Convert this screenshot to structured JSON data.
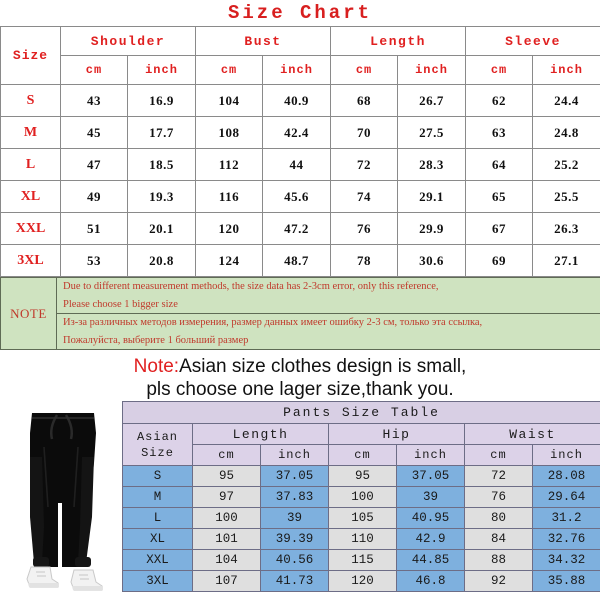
{
  "title": "Size  Chart",
  "shirt_table": {
    "size_header": "Size",
    "groups": [
      "Shoulder",
      "Bust",
      "Length",
      "Sleeve"
    ],
    "units": [
      "cm",
      "inch",
      "cm",
      "inch",
      "cm",
      "inch",
      "cm",
      "inch"
    ],
    "rows": [
      {
        "size": "S",
        "values": [
          "43",
          "16.9",
          "104",
          "40.9",
          "68",
          "26.7",
          "62",
          "24.4"
        ]
      },
      {
        "size": "M",
        "values": [
          "45",
          "17.7",
          "108",
          "42.4",
          "70",
          "27.5",
          "63",
          "24.8"
        ]
      },
      {
        "size": "L",
        "values": [
          "47",
          "18.5",
          "112",
          "44",
          "72",
          "28.3",
          "64",
          "25.2"
        ]
      },
      {
        "size": "XL",
        "values": [
          "49",
          "19.3",
          "116",
          "45.6",
          "74",
          "29.1",
          "65",
          "25.5"
        ]
      },
      {
        "size": "XXL",
        "values": [
          "51",
          "20.1",
          "120",
          "47.2",
          "76",
          "29.9",
          "67",
          "26.3"
        ]
      },
      {
        "size": "3XL",
        "values": [
          "53",
          "20.8",
          "124",
          "48.7",
          "78",
          "30.6",
          "69",
          "27.1"
        ]
      }
    ]
  },
  "note_block": {
    "label": "NOTE",
    "english_line1": "Due to different measurement methods, the size data has 2-3cm error, only this reference,",
    "english_line2": "Please choose 1 bigger size",
    "russian_line1": "Из-за различных методов измерения, размер данных имеет ошибку 2-3 см, только эта ссылка,",
    "russian_line2": "Пожалуйста, выберите 1 больший размер"
  },
  "asian_note": {
    "prefix": "Note:",
    "line1": "Asian size clothes design is small,",
    "line2": "pls choose one lager size,thank you."
  },
  "pants_table": {
    "title": "Pants Size Table",
    "size_header_line1": "Asian",
    "size_header_line2": "Size",
    "groups": [
      "Length",
      "Hip",
      "Waist"
    ],
    "units": [
      "cm",
      "inch",
      "cm",
      "inch",
      "cm",
      "inch"
    ],
    "rows": [
      {
        "size": "S",
        "values": [
          "95",
          "37.05",
          "95",
          "37.05",
          "72",
          "28.08"
        ]
      },
      {
        "size": "M",
        "values": [
          "97",
          "37.83",
          "100",
          "39",
          "76",
          "29.64"
        ]
      },
      {
        "size": "L",
        "values": [
          "100",
          "39",
          "105",
          "40.95",
          "80",
          "31.2"
        ]
      },
      {
        "size": "XL",
        "values": [
          "101",
          "39.39",
          "110",
          "42.9",
          "84",
          "32.76"
        ]
      },
      {
        "size": "XXL",
        "values": [
          "104",
          "40.56",
          "115",
          "44.85",
          "88",
          "34.32"
        ]
      },
      {
        "size": "3XL",
        "values": [
          "107",
          "41.73",
          "120",
          "46.8",
          "92",
          "35.88"
        ]
      }
    ]
  },
  "product_photo": {
    "alt": "black-jogger-pants-photo"
  },
  "colors": {
    "title_red": "#d81f1f",
    "header_red": "#e02020",
    "note_green_bg": "#cfe3c0",
    "note_text_red": "#c0392b",
    "pants_header_lavender": "#dcd2e8",
    "pants_blue": "#7eb0de",
    "pants_gray": "#dfdfdf"
  }
}
